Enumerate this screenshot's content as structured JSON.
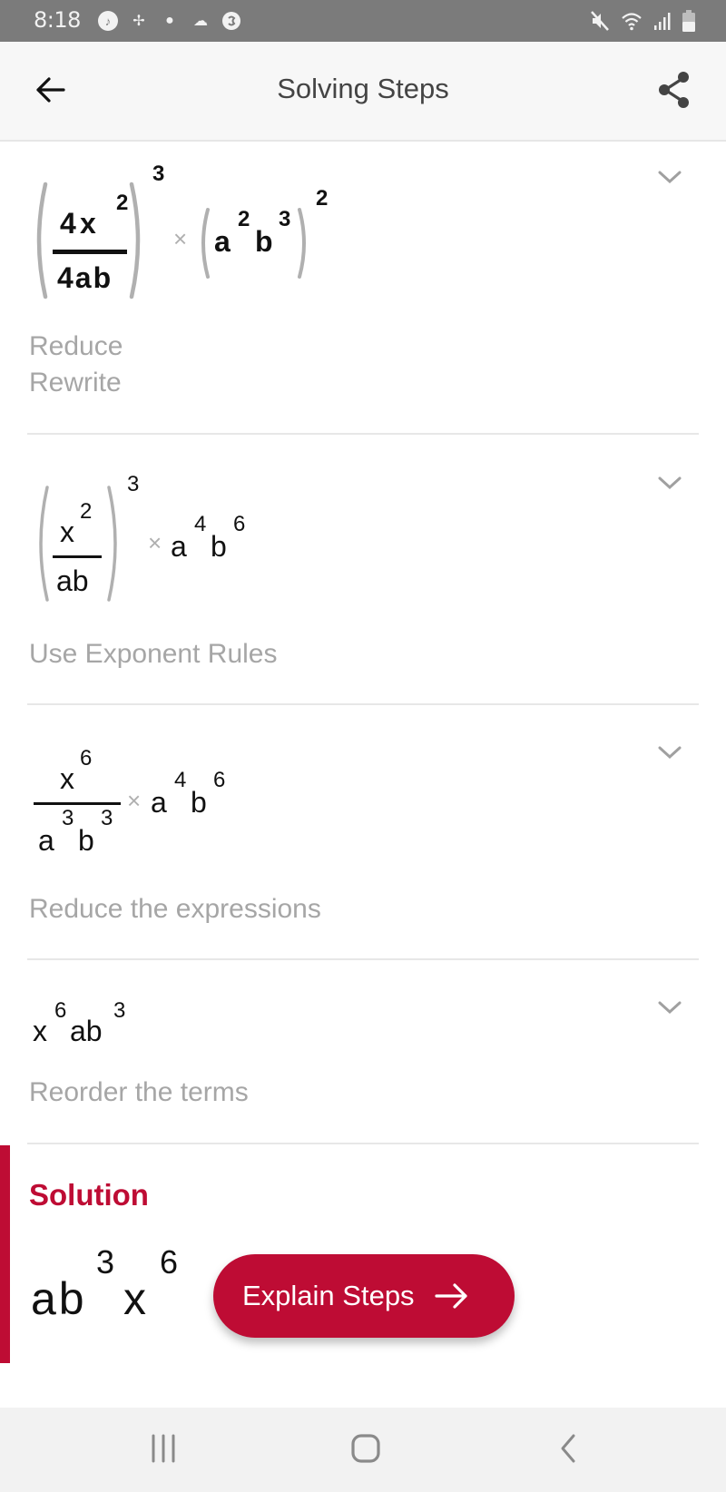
{
  "status_bar": {
    "time": "8:18",
    "left_icons": [
      "music-notification-icon",
      "pinwheel-icon",
      "fruit-app-icon",
      "cloud-icon",
      "shazam-icon"
    ],
    "right_icons": [
      "mute-icon",
      "wifi-icon",
      "signal-icon",
      "battery-icon"
    ]
  },
  "app_bar": {
    "title": "Solving Steps",
    "back_icon": "arrow-left-icon",
    "share_icon": "share-icon"
  },
  "steps": [
    {
      "expression": "(4x^2 / 4ab)^3 × (a^2 b^3)^2",
      "parts": {
        "num_coef": "4",
        "num_var": "x",
        "num_exp": "2",
        "den": "4ab",
        "outer_exp": "3",
        "times": "×",
        "p2_a": "a",
        "p2_a_exp": "2",
        "p2_b": "b",
        "p2_b_exp": "3",
        "p2_outer_exp": "2"
      },
      "descriptions": [
        "Reduce",
        "Rewrite"
      ]
    },
    {
      "expression": "(x^2 / ab)^3 × a^4 b^6",
      "parts": {
        "num_var": "x",
        "num_exp": "2",
        "den": "ab",
        "outer_exp": "3",
        "times": "×",
        "a": "a",
        "a_exp": "4",
        "b": "b",
        "b_exp": "6"
      },
      "descriptions": [
        "Use Exponent Rules"
      ]
    },
    {
      "expression": "x^6 / (a^3 b^3) × a^4 b^6",
      "parts": {
        "num_var": "x",
        "num_exp": "6",
        "den_a": "a",
        "den_a_exp": "3",
        "den_b": "b",
        "den_b_exp": "3",
        "times": "×",
        "a": "a",
        "a_exp": "4",
        "b": "b",
        "b_exp": "6"
      },
      "descriptions": [
        "Reduce the expressions"
      ]
    },
    {
      "expression": "x^6 a b^3",
      "parts": {
        "x": "x",
        "x_exp": "6",
        "ab": "ab",
        "b_exp": "3"
      },
      "descriptions": [
        "Reorder the terms"
      ]
    }
  ],
  "solution": {
    "label": "Solution",
    "expression": "ab^3 x^6",
    "parts": {
      "ab": "ab",
      "b_exp": "3",
      "x": "x",
      "x_exp": "6"
    },
    "button_label": "Explain Steps",
    "accent_color": "#be0c34"
  },
  "nav_bar": {
    "icons": [
      "recent-apps-icon",
      "home-icon",
      "back-icon"
    ]
  }
}
